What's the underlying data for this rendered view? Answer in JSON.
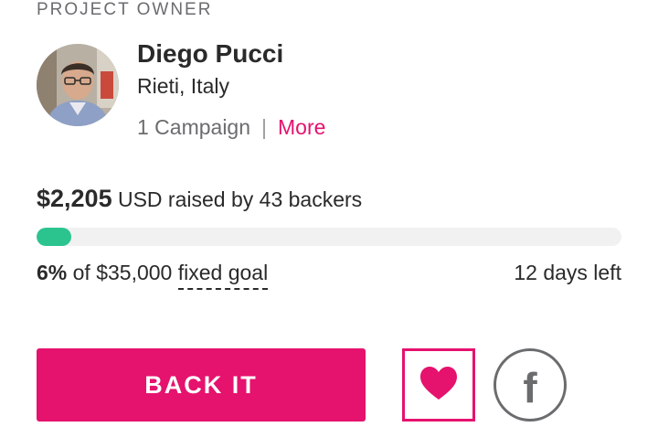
{
  "owner_section": {
    "label": "PROJECT OWNER",
    "name": "Diego Pucci",
    "location": "Rieti, Italy",
    "campaigns": "1 Campaign",
    "separator": "|",
    "more_link": "More"
  },
  "funding": {
    "raised_amount": "$2,205",
    "raised_suffix": " USD raised by 43 backers",
    "progress_percent": 6,
    "percent_label": "6%",
    "goal_text": " of $35,000 ",
    "goal_type": "fixed goal",
    "days_left": "12 days left"
  },
  "actions": {
    "back_label": "BACK IT",
    "follow_icon": "heart-icon",
    "share_icon": "facebook-icon",
    "facebook_glyph": "f"
  },
  "colors": {
    "accent": "#e5126e",
    "progress": "#2bc48f",
    "track": "#f1f1f1",
    "muted": "#6a6c6e"
  }
}
